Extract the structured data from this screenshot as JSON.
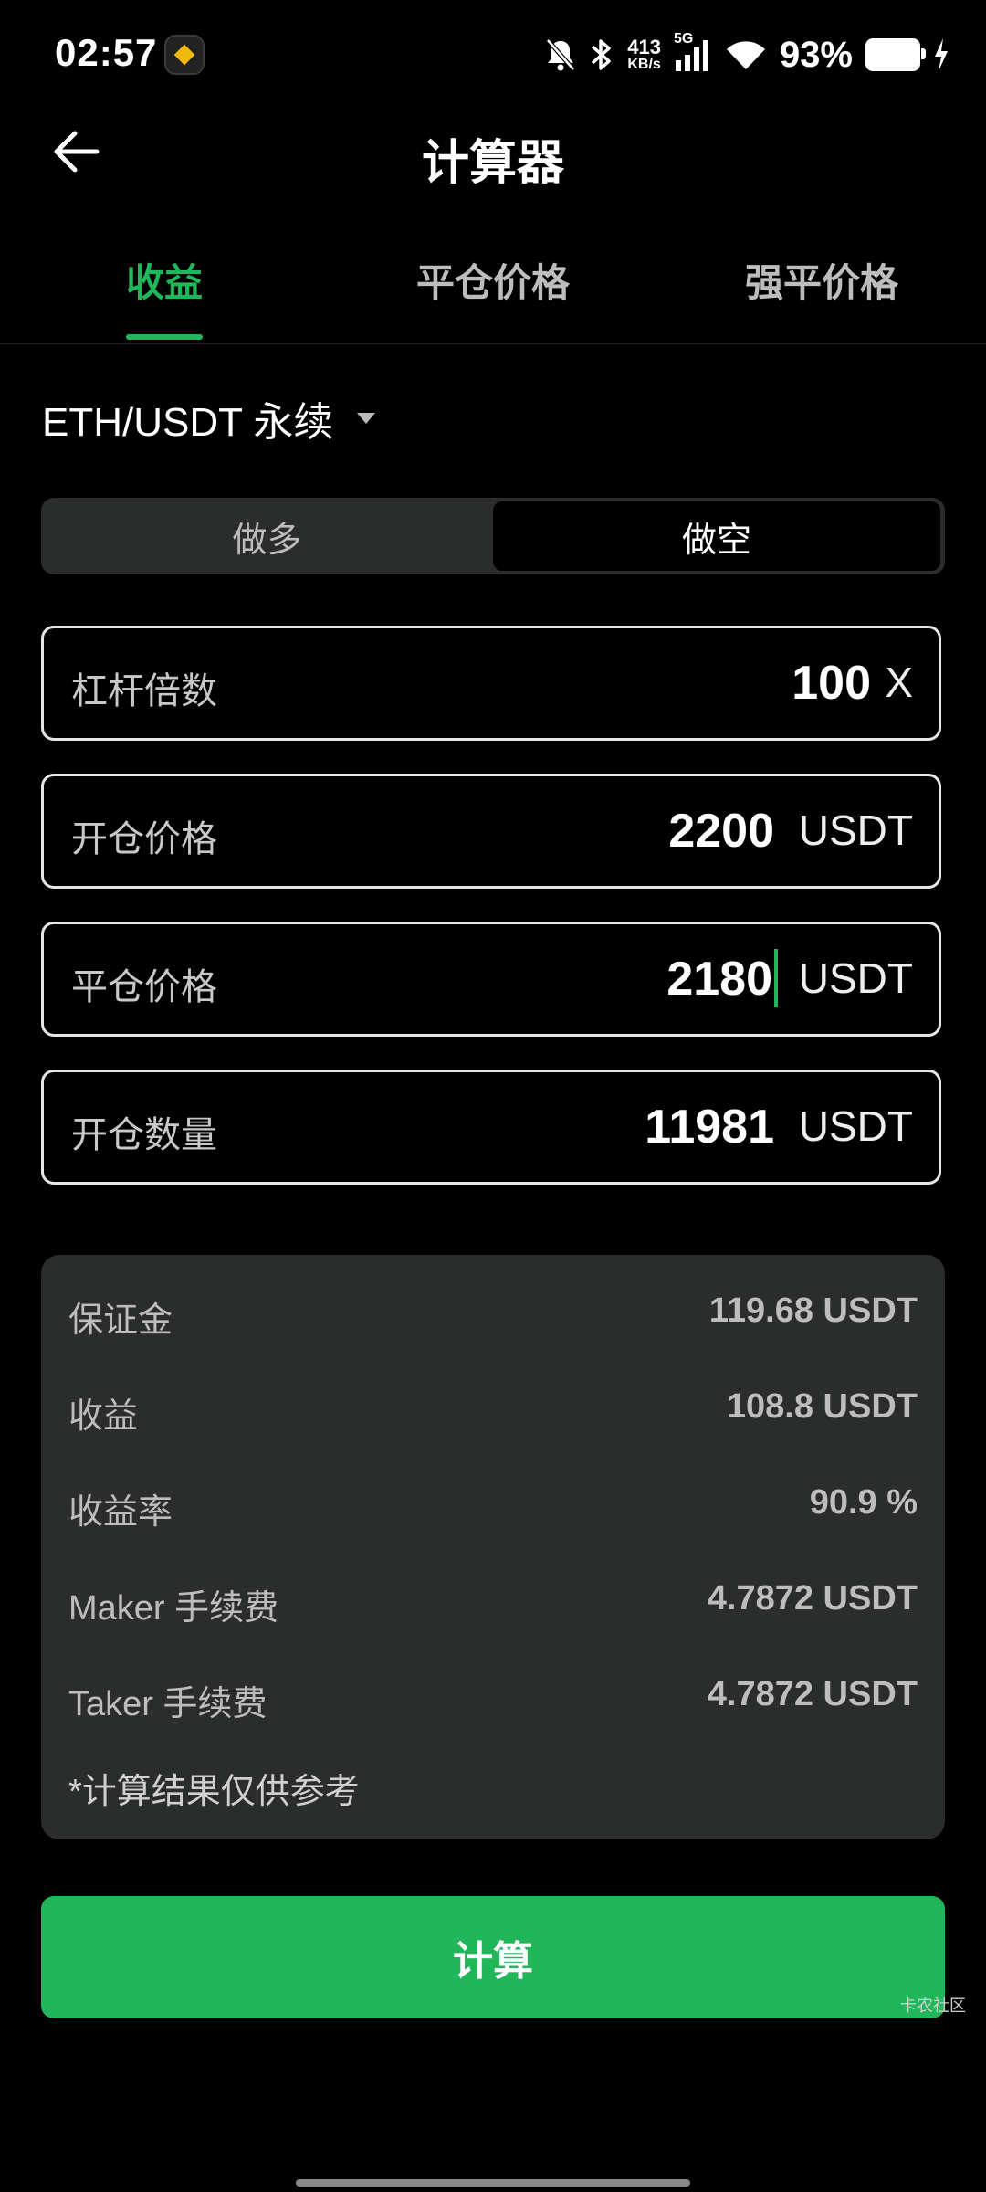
{
  "status_bar": {
    "time": "02:57",
    "net_speed_value": "413",
    "net_speed_unit": "KB/s",
    "network_type": "5G",
    "battery_percent": "93%"
  },
  "header": {
    "title": "计算器"
  },
  "tabs": [
    {
      "label": "收益",
      "active": true
    },
    {
      "label": "平仓价格",
      "active": false
    },
    {
      "label": "强平价格",
      "active": false
    }
  ],
  "pair": {
    "label": "ETH/USDT 永续"
  },
  "direction": {
    "long_label": "做多",
    "short_label": "做空",
    "selected": "做空"
  },
  "fields": {
    "leverage": {
      "label": "杠杆倍数",
      "value": "100",
      "unit": "X"
    },
    "open_price": {
      "label": "开仓价格",
      "value": "2200",
      "unit": "USDT"
    },
    "close_price": {
      "label": "平仓价格",
      "value": "2180",
      "unit": "USDT"
    },
    "quantity": {
      "label": "开仓数量",
      "value": "11981",
      "unit": "USDT"
    }
  },
  "results": [
    {
      "key": "保证金",
      "value": "119.68 USDT"
    },
    {
      "key": "收益",
      "value": "108.8 USDT"
    },
    {
      "key": "收益率",
      "value": "90.9 %"
    },
    {
      "key": "Maker 手续费",
      "value": "4.7872 USDT"
    },
    {
      "key": "Taker 手续费",
      "value": "4.7872 USDT"
    }
  ],
  "note": "*计算结果仅供参考",
  "calculate_button": "计算",
  "watermark": "卡农社区",
  "colors": {
    "accent": "#1fb75a",
    "card_bg": "#2b2c2c",
    "background": "#000000"
  }
}
